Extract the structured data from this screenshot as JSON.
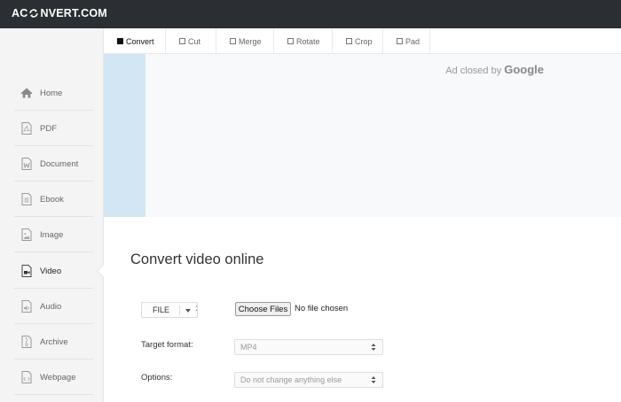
{
  "header": {
    "logo_left": "AC",
    "logo_right": "NVERT.COM"
  },
  "sidebar": {
    "items": [
      {
        "label": "Home",
        "icon": "home-icon"
      },
      {
        "label": "PDF",
        "icon": "pdf-file-icon"
      },
      {
        "label": "Document",
        "icon": "word-document-icon"
      },
      {
        "label": "Ebook",
        "icon": "ebook-icon"
      },
      {
        "label": "Image",
        "icon": "image-icon"
      },
      {
        "label": "Video",
        "icon": "video-icon"
      },
      {
        "label": "Audio",
        "icon": "audio-icon"
      },
      {
        "label": "Archive",
        "icon": "archive-icon"
      },
      {
        "label": "Webpage",
        "icon": "webpage-icon"
      }
    ],
    "active": "Video"
  },
  "tabs": [
    {
      "label": "Convert",
      "active": true
    },
    {
      "label": "Cut",
      "active": false
    },
    {
      "label": "Merge",
      "active": false
    },
    {
      "label": "Rotate",
      "active": false
    },
    {
      "label": "Crop",
      "active": false
    },
    {
      "label": "Pad",
      "active": false
    }
  ],
  "ad": {
    "closed_text": "Ad closed by",
    "brand": "Google"
  },
  "main": {
    "title": "Convert video online",
    "file_button": "FILE",
    "colon": ":",
    "choose_files": "Choose Files",
    "no_file": "No file chosen",
    "target_format_label": "Target format:",
    "target_format_value": "MP4",
    "options_label": "Options:",
    "options_value": "Do not change anything else"
  },
  "colors": {
    "topbar": "#2b2e33",
    "sidebar": "#f4f4f4",
    "ad_stripe": "#d3e6f3"
  }
}
